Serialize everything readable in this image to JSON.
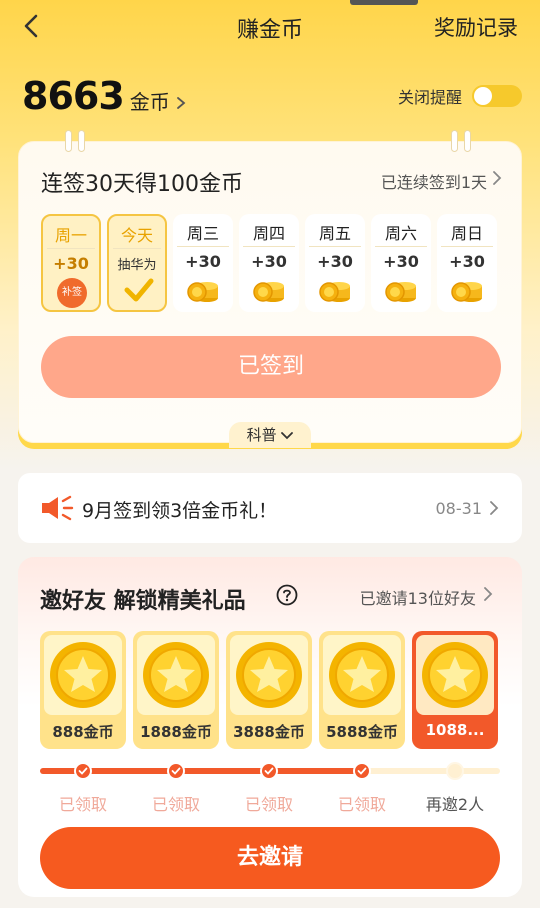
{
  "header": {
    "title": "赚金币",
    "records_label": "奖励记录"
  },
  "balance": {
    "amount": "8663",
    "unit": "金币"
  },
  "reminder": {
    "label": "关闭提醒",
    "enabled": false
  },
  "checkin": {
    "title": "连签30天得100金币",
    "streak_text": "已连续签到1天",
    "days": [
      {
        "label": "周一",
        "points": "+30",
        "note": "补签",
        "state": "makeup"
      },
      {
        "label": "今天",
        "points": "抽华为",
        "note": "",
        "state": "today-done"
      },
      {
        "label": "周三",
        "points": "+30",
        "state": "upcoming"
      },
      {
        "label": "周四",
        "points": "+30",
        "state": "upcoming"
      },
      {
        "label": "周五",
        "points": "+30",
        "state": "upcoming"
      },
      {
        "label": "周六",
        "points": "+30",
        "state": "upcoming"
      },
      {
        "label": "周日",
        "points": "+30",
        "state": "upcoming"
      }
    ],
    "signed_button": "已签到",
    "kepu_label": "科普"
  },
  "notice": {
    "text": "9月签到领3倍金币礼！",
    "date": "08-31"
  },
  "invite": {
    "title": "邀好友 解锁精美礼品",
    "invited_text": "已邀请13位好友",
    "rewards": [
      {
        "amount": "888金币",
        "status": "已领取"
      },
      {
        "amount": "1888金币",
        "status": "已领取"
      },
      {
        "amount": "3888金币",
        "status": "已领取"
      },
      {
        "amount": "5888金币",
        "status": "已领取"
      },
      {
        "amount": "1088...",
        "status": "再邀2人"
      }
    ],
    "progress_fraction": 0.8,
    "button": "去邀请"
  },
  "colors": {
    "accent": "#f65a1f",
    "gold": "#f5c542",
    "signed": "#ffa78a"
  }
}
